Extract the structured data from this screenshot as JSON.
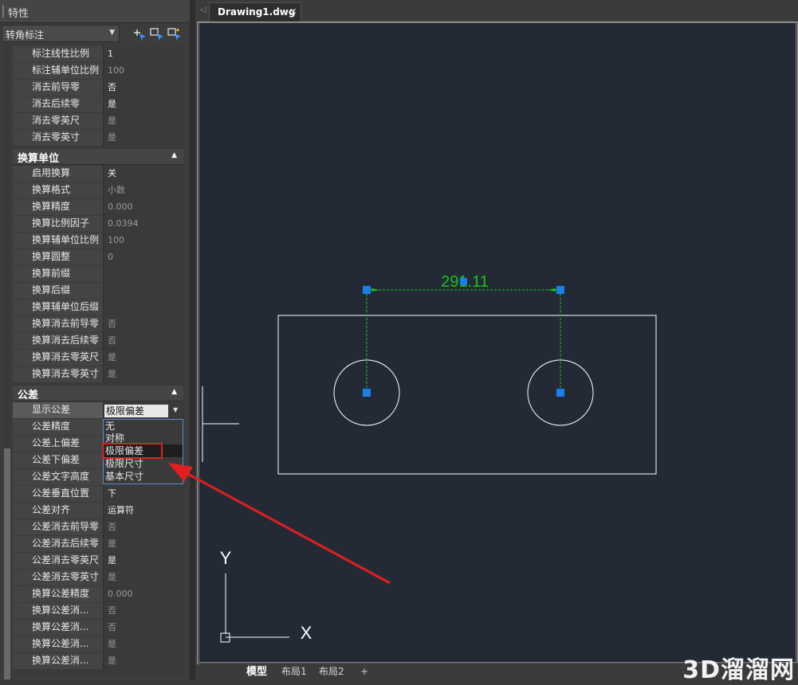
{
  "panel": {
    "title": "特性",
    "selection": "转角标注"
  },
  "sections": [
    {
      "id": "primary",
      "title": "",
      "rows": [
        {
          "label": "标注线性比例",
          "value": "1",
          "enabled": true
        },
        {
          "label": "标注辅单位比例",
          "value": "100",
          "enabled": false
        },
        {
          "label": "消去前导零",
          "value": "否",
          "enabled": true
        },
        {
          "label": "消去后续零",
          "value": "是",
          "enabled": true
        },
        {
          "label": "消去零英尺",
          "value": "是",
          "enabled": false
        },
        {
          "label": "消去零英寸",
          "value": "是",
          "enabled": false
        }
      ]
    },
    {
      "id": "alt",
      "title": "换算单位",
      "rows": [
        {
          "label": "启用换算",
          "value": "关",
          "enabled": true
        },
        {
          "label": "换算格式",
          "value": "小数",
          "enabled": false
        },
        {
          "label": "换算精度",
          "value": "0.000",
          "enabled": false
        },
        {
          "label": "换算比例因子",
          "value": "0.0394",
          "enabled": false
        },
        {
          "label": "换算辅单位比例",
          "value": "100",
          "enabled": false
        },
        {
          "label": "换算圆整",
          "value": "0",
          "enabled": false
        },
        {
          "label": "换算前缀",
          "value": "",
          "enabled": false
        },
        {
          "label": "换算后缀",
          "value": "",
          "enabled": false
        },
        {
          "label": "换算辅单位后缀",
          "value": "",
          "enabled": false
        },
        {
          "label": "换算消去前导零",
          "value": "否",
          "enabled": false
        },
        {
          "label": "换算消去后续零",
          "value": "否",
          "enabled": false
        },
        {
          "label": "换算消去零英尺",
          "value": "是",
          "enabled": false
        },
        {
          "label": "换算消去零英寸",
          "value": "是",
          "enabled": false
        }
      ]
    },
    {
      "id": "tol",
      "title": "公差",
      "rows": [
        {
          "label": "显示公差",
          "value": "",
          "enabled": true
        },
        {
          "label": "公差精度",
          "value": "",
          "enabled": true
        },
        {
          "label": "公差上偏差",
          "value": "",
          "enabled": true
        },
        {
          "label": "公差下偏差",
          "value": "",
          "enabled": true
        },
        {
          "label": "公差文字高度",
          "value": "",
          "enabled": true
        },
        {
          "label": "公差垂直位置",
          "value": "下",
          "enabled": true
        },
        {
          "label": "公差对齐",
          "value": "运算符",
          "enabled": true
        },
        {
          "label": "公差消去前导零",
          "value": "否",
          "enabled": false
        },
        {
          "label": "公差消去后续零",
          "value": "是",
          "enabled": false
        },
        {
          "label": "公差消去零英尺",
          "value": "是",
          "enabled": true
        },
        {
          "label": "公差消去零英寸",
          "value": "是",
          "enabled": false
        },
        {
          "label": "换算公差精度",
          "value": "0.000",
          "enabled": false
        },
        {
          "label": "换算公差消...",
          "value": "否",
          "enabled": false
        },
        {
          "label": "换算公差消...",
          "value": "否",
          "enabled": false
        },
        {
          "label": "换算公差消...",
          "value": "是",
          "enabled": false
        },
        {
          "label": "换算公差消...",
          "value": "是",
          "enabled": false
        }
      ]
    }
  ],
  "tolerance_dropdown": {
    "current": "极限偏差",
    "options": [
      "无",
      "对称",
      "极限偏差",
      "极限尺寸",
      "基本尺寸"
    ],
    "selected_index": 2
  },
  "document": {
    "tab_name": "Drawing1.dwg",
    "close_glyph": "×",
    "nav_glyph": "◁"
  },
  "drawing": {
    "dimension_text": "291.11",
    "axis_x_label": "X",
    "axis_y_label": "Y",
    "dimension_color": "#19c419",
    "grip_color": "#1a7fe8",
    "line_color": "#ffffff"
  },
  "layout_tabs": [
    "模型",
    "布局1",
    "布局2",
    "+"
  ],
  "watermark": "3D溜溜网",
  "colors": {
    "highlight_box": "#e0201f",
    "arrow": "#e0201f",
    "canvas_bg": "#232a35"
  }
}
